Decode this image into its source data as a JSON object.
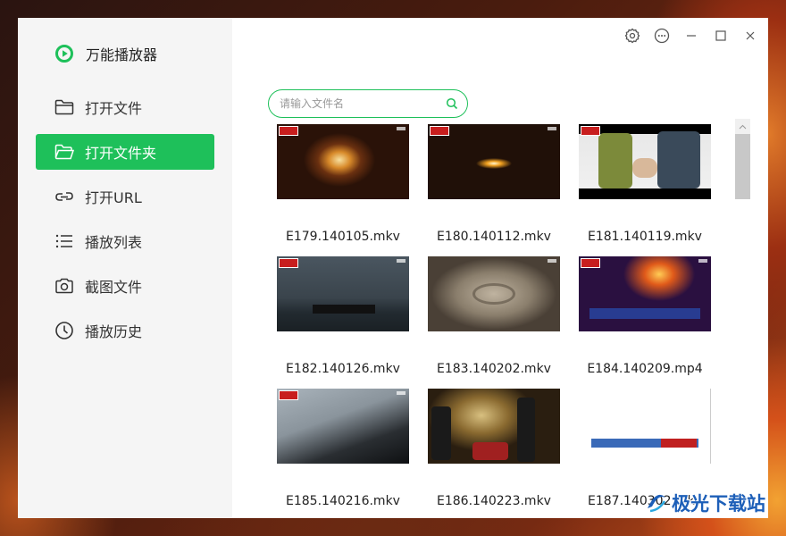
{
  "app": {
    "title": "万能播放器"
  },
  "sidebar": {
    "items": [
      {
        "label": "打开文件",
        "icon": "folder-icon",
        "active": false
      },
      {
        "label": "打开文件夹",
        "icon": "folder-open-icon",
        "active": true
      },
      {
        "label": "打开URL",
        "icon": "link-icon",
        "active": false
      },
      {
        "label": "播放列表",
        "icon": "list-icon",
        "active": false
      },
      {
        "label": "截图文件",
        "icon": "camera-icon",
        "active": false
      },
      {
        "label": "播放历史",
        "icon": "clock-icon",
        "active": false
      }
    ]
  },
  "search": {
    "placeholder": "请输入文件名",
    "value": ""
  },
  "files": [
    {
      "name": "E179.140105.mkv"
    },
    {
      "name": "E180.140112.mkv"
    },
    {
      "name": "E181.140119.mkv"
    },
    {
      "name": "E182.140126.mkv"
    },
    {
      "name": "E183.140202.mkv"
    },
    {
      "name": "E184.140209.mp4"
    },
    {
      "name": "E185.140216.mkv"
    },
    {
      "name": "E186.140223.mkv"
    },
    {
      "name": "E187.140302.mkv"
    }
  ],
  "watermark": {
    "text": "极光下载站"
  },
  "colors": {
    "accent": "#1ec05a",
    "sidebar_bg": "#f5f5f5"
  }
}
